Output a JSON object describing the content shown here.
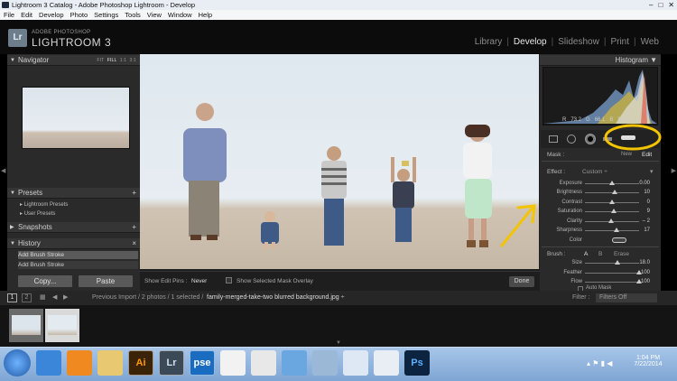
{
  "window": {
    "title": "Lightroom 3 Catalog - Adobe Photoshop Lightroom - Develop",
    "controls": [
      "–",
      "□",
      "✕"
    ]
  },
  "menu": [
    "File",
    "Edit",
    "Develop",
    "Photo",
    "Settings",
    "Tools",
    "View",
    "Window",
    "Help"
  ],
  "identity": {
    "logo": "Lr",
    "brand_small": "ADOBE PHOTOSHOP",
    "brand_large": "LIGHTROOM 3"
  },
  "modules": {
    "items": [
      "Library",
      "Develop",
      "Slideshow",
      "Print",
      "Web"
    ],
    "selected": "Develop",
    "separator": "|"
  },
  "navigator": {
    "title": "Navigator",
    "options": [
      "FIT",
      "FILL",
      "1:1",
      "3:1"
    ],
    "selected_option": "FILL"
  },
  "presets": {
    "title": "Presets",
    "items": [
      "Lightroom Presets",
      "User Presets"
    ]
  },
  "snapshots": {
    "title": "Snapshots"
  },
  "history": {
    "title": "History",
    "close": "×",
    "items": [
      "Add Brush Stroke",
      "Add Brush Stroke"
    ]
  },
  "buttons": {
    "copy": "Copy...",
    "paste": "Paste",
    "done": "Done"
  },
  "toolbar": {
    "show_edit_pins_label": "Show Edit Pins :",
    "show_edit_pins_value": "Never",
    "overlay_label": "Show Selected Mask Overlay"
  },
  "histogram": {
    "title": "Histogram",
    "r_label": "R",
    "r": "73.2",
    "g_label": "G",
    "g": "66.1",
    "b_label": "B",
    "b": "53.1"
  },
  "mask": {
    "label": "Mask :",
    "new": "New",
    "edit": "Edit"
  },
  "effect": {
    "label": "Effect :",
    "value": "Custom ÷",
    "sliders": [
      {
        "label": "Exposure",
        "value": "0.00",
        "pos": 0.5
      },
      {
        "label": "Brightness",
        "value": "10",
        "pos": 0.55
      },
      {
        "label": "Contrast",
        "value": "0",
        "pos": 0.5
      },
      {
        "label": "Saturation",
        "value": "9",
        "pos": 0.54
      },
      {
        "label": "Clarity",
        "value": "– 2",
        "pos": 0.49
      },
      {
        "label": "Sharpness",
        "value": "17",
        "pos": 0.58
      }
    ],
    "color_label": "Color"
  },
  "brush": {
    "label": "Brush :",
    "a": "A",
    "b": "B",
    "erase": "Erase",
    "sliders": [
      {
        "label": "Size",
        "value": "18.0",
        "pos": 0.6
      },
      {
        "label": "Feather",
        "value": "100",
        "pos": 1.0
      },
      {
        "label": "Flow",
        "value": "100",
        "pos": 1.0
      }
    ],
    "automask": "Auto Mask"
  },
  "filmstrip": {
    "pages": [
      "1",
      "2"
    ],
    "path": "Previous Import / 2 photos / 1 selected /",
    "filename": "family-merged-take-two blurred background.jpg ÷",
    "filter_label": "Filter :",
    "filter_value": "Filters Off"
  },
  "taskbar": {
    "time": "1:04 PM",
    "date": "7/22/2014",
    "apps": [
      {
        "name": "ie",
        "label": ""
      },
      {
        "name": "media",
        "label": ""
      },
      {
        "name": "explorer",
        "label": ""
      },
      {
        "name": "illustrator",
        "label": "Ai"
      },
      {
        "name": "lightroom",
        "label": "Lr"
      },
      {
        "name": "pse",
        "label": "pse"
      },
      {
        "name": "picasa",
        "label": ""
      },
      {
        "name": "chrome",
        "label": ""
      },
      {
        "name": "photo-viewer",
        "label": ""
      },
      {
        "name": "computer",
        "label": ""
      },
      {
        "name": "notepad",
        "label": ""
      },
      {
        "name": "paint",
        "label": ""
      },
      {
        "name": "photoshop",
        "label": "Ps"
      }
    ]
  },
  "colors": {
    "accent_yellow": "#f3c400",
    "panel": "#2a2a2a",
    "brand_blue": "#6e7d8c"
  }
}
